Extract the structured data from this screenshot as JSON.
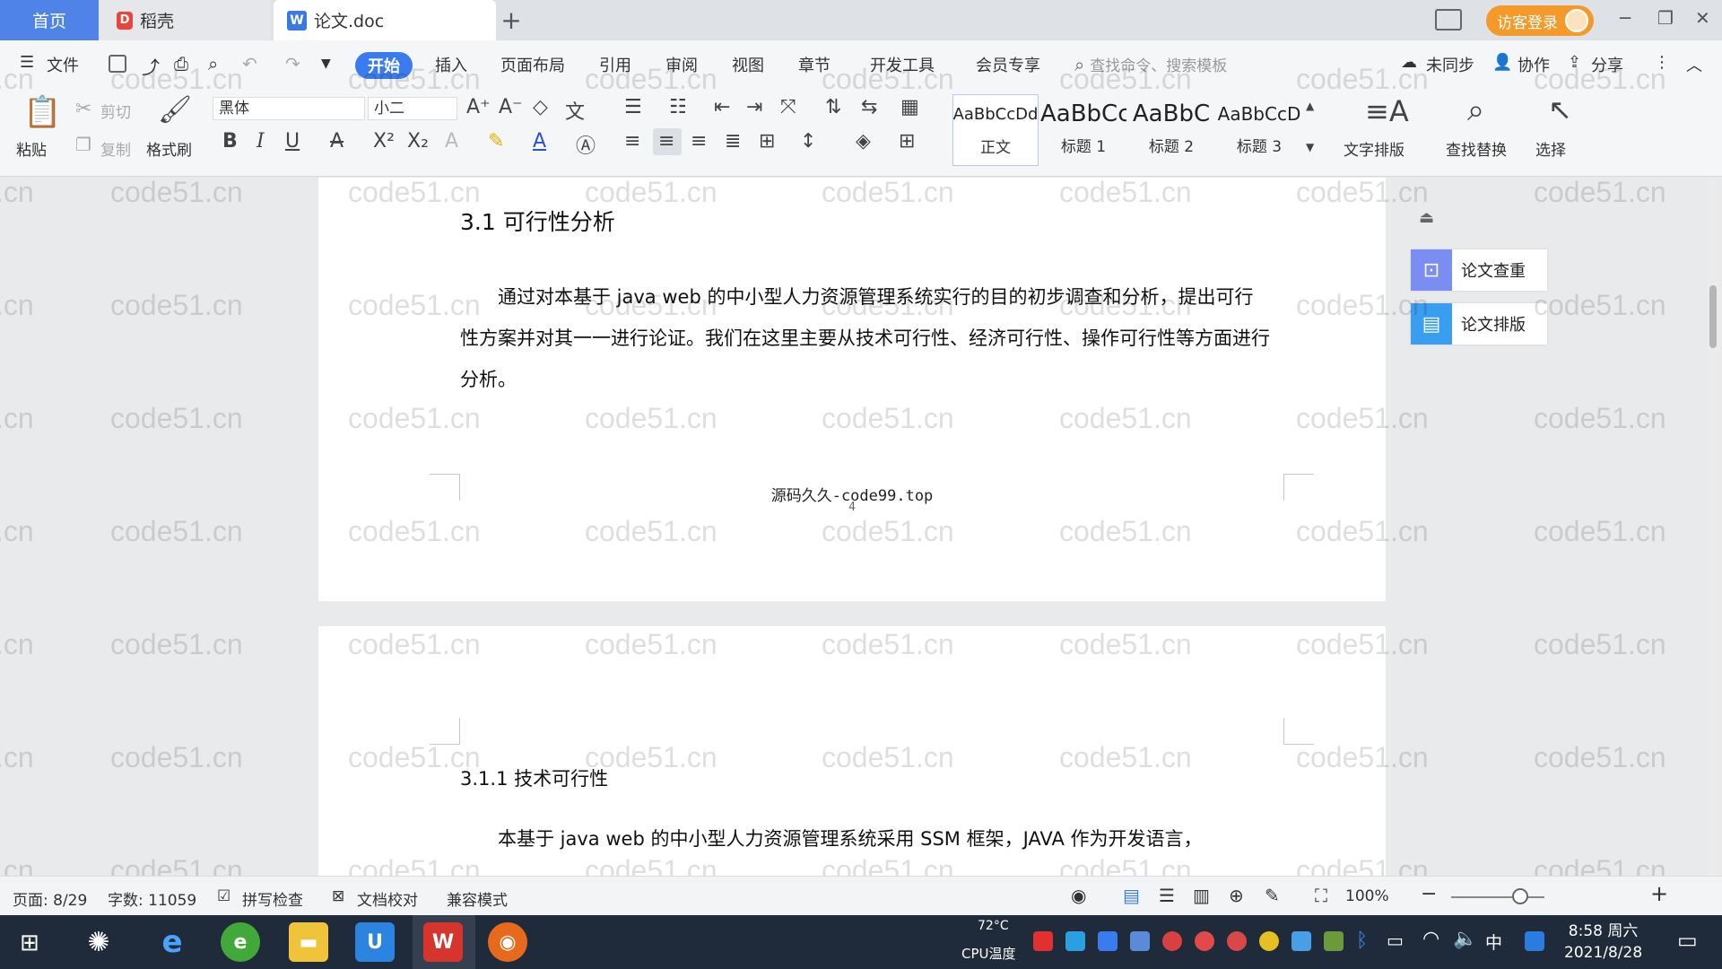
{
  "tabs": {
    "home": "首页",
    "daoke": "稻壳",
    "doc": "论文.doc",
    "add": "+"
  },
  "titlebar": {
    "login": "访客登录"
  },
  "menu": {
    "file": "文件",
    "items": [
      "开始",
      "插入",
      "页面布局",
      "引用",
      "审阅",
      "视图",
      "章节",
      "开发工具",
      "会员专享"
    ],
    "search": "查找命令、搜索模板",
    "sync": "未同步",
    "collab": "协作",
    "share": "分享"
  },
  "ribbon": {
    "paste": "粘贴",
    "cut": "剪切",
    "copy": "复制",
    "format_painter": "格式刷",
    "font": "黑体",
    "size": "小二",
    "styles": [
      {
        "preview": "AaBbCcDd",
        "name": "正文"
      },
      {
        "preview": "AaBbCc",
        "name": "标题 1"
      },
      {
        "preview": "AaBbC",
        "name": "标题 2"
      },
      {
        "preview": "AaBbCcD",
        "name": "标题 3"
      }
    ],
    "text_layout": "文字排版",
    "find_replace": "查找替换",
    "select": "选择"
  },
  "document": {
    "heading1": "3.1 可行性分析",
    "paragraph1": "通过对本基于 java web 的中小型人力资源管理系统实行的目的初步调查和分析，提出可行性方案并对其一一进行论证。我们在这里主要从技术可行性、经济可行性、操作可行性等方面进行分析。",
    "footer": "源码久久-code99.top",
    "page_number": "4",
    "heading2": "3.1.1 技术可行性",
    "paragraph2": "本基于 java web 的中小型人力资源管理系统采用 SSM 框架，JAVA 作为开发语言，"
  },
  "watermark": "code51.cn",
  "side_panel": {
    "check": "论文查重",
    "layout": "论文排版"
  },
  "status": {
    "page": "页面: 8/29",
    "words": "字数: 11059",
    "spell": "拼写检查",
    "proof": "文档校对",
    "compat": "兼容模式",
    "zoom": "100%",
    "zoom_level": 1.0
  },
  "taskbar": {
    "cpu_temp": "72°C",
    "cpu_label": "CPU温度",
    "ime": "中",
    "time": "8:58 周六",
    "date": "2021/8/28"
  },
  "colors": {
    "accent": "#3a7cf0",
    "home_tab": "#4f83e8",
    "login": "#f39a2b"
  }
}
